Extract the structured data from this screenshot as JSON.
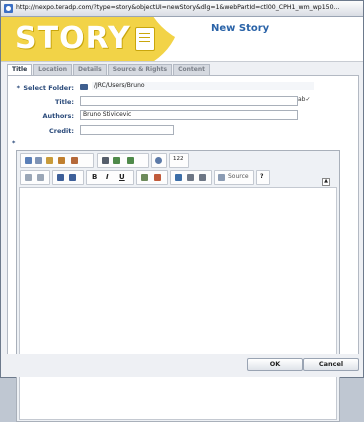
{
  "window": {
    "url": "http://nexpo.teradp.com/?type=story&objectUI=newStory&dlg=1&webPartId=ctl00_CPH1_wm_wp150..."
  },
  "banner": {
    "logo_text": "STORY",
    "title": "New Story"
  },
  "tabs": [
    {
      "label": "Title",
      "active": true
    },
    {
      "label": "Location",
      "active": false
    },
    {
      "label": "Details",
      "active": false
    },
    {
      "label": "Source & Rights",
      "active": false
    },
    {
      "label": "Content",
      "active": false
    }
  ],
  "form": {
    "select_folder_label": "Select Folder:",
    "folder_value": "/JRC/Users/Bruno",
    "title_label": "Title:",
    "title_value": "",
    "authors_label": "Authors:",
    "authors_value": "Bruno Stivicevic",
    "credit_label": "Credit:",
    "credit_value": "",
    "required_marker": "*"
  },
  "editor": {
    "zoom_label": "122",
    "source_label": "Source",
    "bold_label": "B",
    "italic_label": "I",
    "underline_label": "U",
    "help_label": "?",
    "collapse_label": "▲"
  },
  "footer": {
    "ok_label": "OK",
    "cancel_label": "Cancel"
  }
}
